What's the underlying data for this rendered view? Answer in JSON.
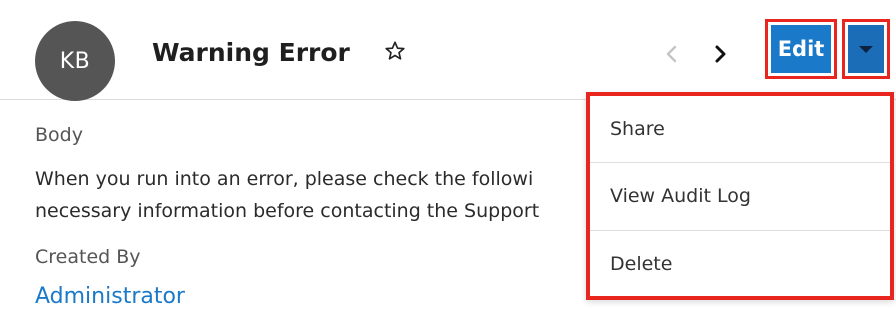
{
  "record": {
    "avatar_initials": "KB",
    "title": "Warning Error",
    "star_icon": "star-outline-icon"
  },
  "nav": {
    "prev_icon": "chevron-left-icon",
    "next_icon": "chevron-right-icon"
  },
  "actions": {
    "edit_label": "Edit",
    "dropdown_icon": "caret-down-icon",
    "menu": [
      "Share",
      "View Audit Log",
      "Delete"
    ]
  },
  "fields": {
    "body_label": "Body",
    "body_line1": "When you run into an error, please check the followi",
    "body_line2": "necessary information before contacting the Support",
    "created_by_label": "Created By",
    "created_by_value": "Administrator"
  },
  "colors": {
    "accent": "#1b79c9",
    "highlight": "#e8251f",
    "avatar_bg": "#555555"
  }
}
